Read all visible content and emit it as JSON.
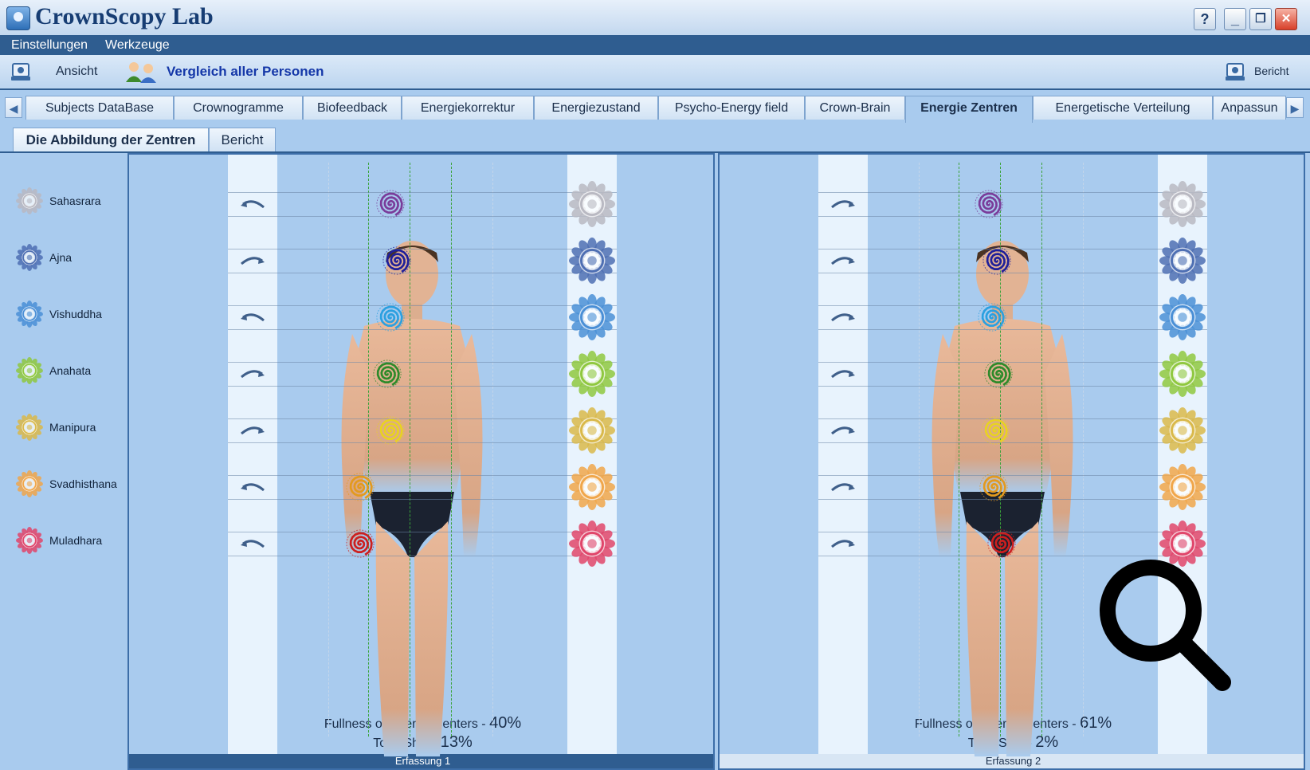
{
  "window": {
    "title": "CrownScopy Lab",
    "help": "?",
    "minimize": "_",
    "restore": "❐",
    "close": "✕"
  },
  "menu": {
    "items": [
      "Einstellungen",
      "Werkzeuge"
    ]
  },
  "toolbar": {
    "view_label": "Ansicht",
    "compare_label": "Vergleich aller Personen",
    "report_label": "Bericht"
  },
  "tabs": {
    "items": [
      "Subjects DataBase",
      "Crownogramme",
      "Biofeedback",
      "Energiekorrektur",
      "Energiezustand",
      "Psycho-Energy field",
      "Crown-Brain",
      "Energie Zentren",
      "Energetische Verteilung",
      "Anpassun"
    ],
    "active": "Energie Zentren",
    "scroll_left": "◀",
    "scroll_right": "▶"
  },
  "subtabs": {
    "items": [
      "Die Abbildung der Zentren",
      "Bericht"
    ],
    "active": "Die Abbildung der Zentren"
  },
  "chakras": [
    {
      "name": "Sahasrara",
      "color": "#b9b9c2",
      "spiral": "#7a3c9a"
    },
    {
      "name": "Ajna",
      "color": "#4e6fb3",
      "spiral": "#1f1f9a"
    },
    {
      "name": "Vishuddha",
      "color": "#4a8fd6",
      "spiral": "#2ba0e0"
    },
    {
      "name": "Anahata",
      "color": "#8fc83f",
      "spiral": "#2e8a2a"
    },
    {
      "name": "Manipura",
      "color": "#d9b94a",
      "spiral": "#e8d222"
    },
    {
      "name": "Svadhisthana",
      "color": "#f0a64a",
      "spiral": "#e39a1e"
    },
    {
      "name": "Muladhara",
      "color": "#e0456a",
      "spiral": "#cc1f1f"
    }
  ],
  "panels": [
    {
      "fullness_label": "Fullness of Energy Centers - ",
      "fullness_value": "40%",
      "shift_label": "Total Shift - ",
      "shift_value": "13%",
      "footer": "Erfassung 1",
      "rotations": [
        "ccw",
        "cw",
        "ccw",
        "cw",
        "cw",
        "ccw",
        "ccw"
      ]
    },
    {
      "fullness_label": "Fullness of Energy Centers - ",
      "fullness_value": "61%",
      "shift_label": "Total Shift - ",
      "shift_value": "2%",
      "footer": "Erfassung 2",
      "rotations": [
        "cw",
        "cw",
        "cw",
        "cw",
        "cw",
        "cw",
        "cw"
      ]
    }
  ]
}
